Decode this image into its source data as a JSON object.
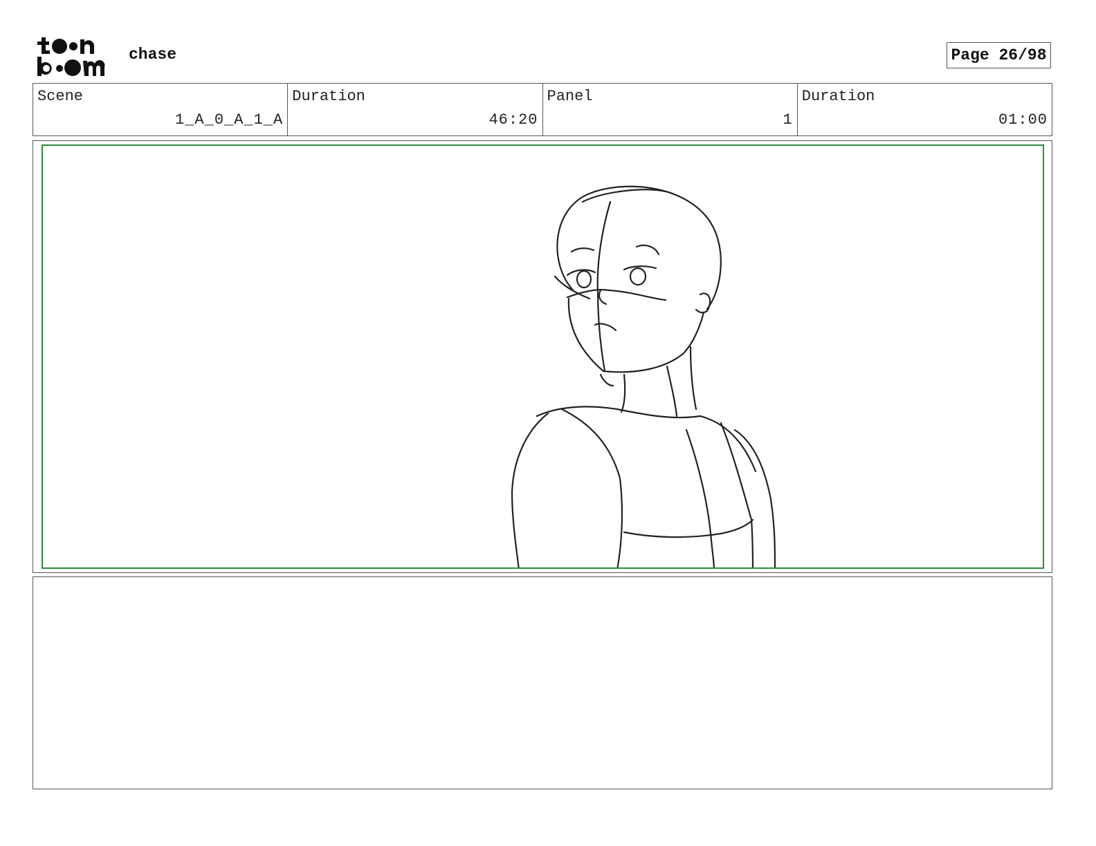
{
  "header": {
    "logo_text_top": "toon",
    "logo_text_bottom": "boom",
    "project_title": "chase",
    "page_label": "Page 26/98"
  },
  "info": {
    "scene_label": "Scene",
    "scene_value": "1_A_0_A_1_A",
    "scene_duration_label": "Duration",
    "scene_duration_value": "46:20",
    "panel_label": "Panel",
    "panel_value": "1",
    "panel_duration_label": "Duration",
    "panel_duration_value": "01:00"
  },
  "panel": {
    "safe_frame_color": "#2e8b3a",
    "sketch_subject": "rough pencil sketch of a character's head and torso"
  },
  "notes": {
    "text": ""
  }
}
